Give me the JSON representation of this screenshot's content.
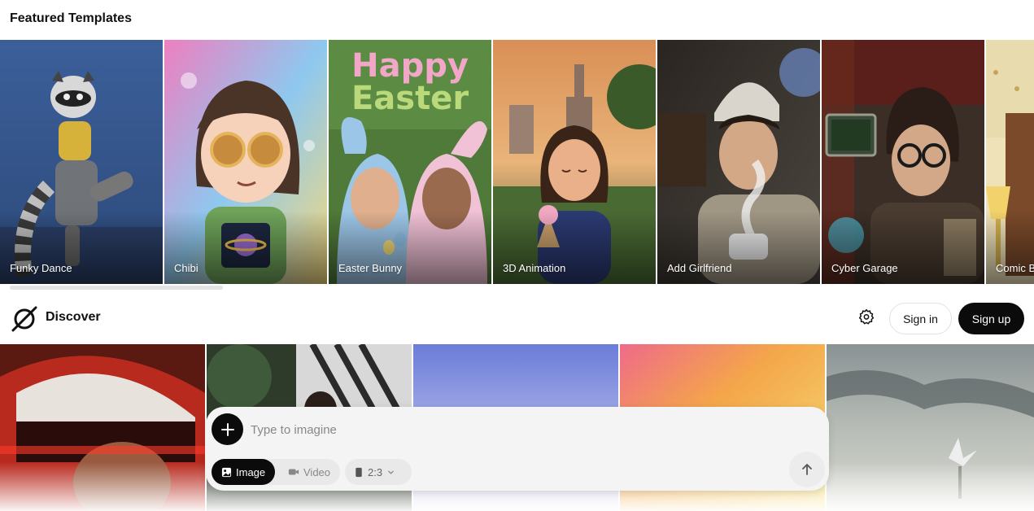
{
  "featured": {
    "title": "Featured Templates",
    "templates": [
      {
        "label": "Funky Dance"
      },
      {
        "label": "Chibi"
      },
      {
        "label": "Easter Bunny"
      },
      {
        "label": "3D Animation"
      },
      {
        "label": "Add Girlfriend"
      },
      {
        "label": "Cyber Garage"
      },
      {
        "label": "Comic B"
      }
    ]
  },
  "header": {
    "title": "Discover",
    "sign_in": "Sign in",
    "sign_up": "Sign up",
    "settings_icon": "gear-icon",
    "logo_icon": "brand-logo"
  },
  "easter_art": {
    "line1": "Happy",
    "line2": "Easter"
  },
  "composer": {
    "placeholder": "Type to imagine",
    "modes": [
      {
        "label": "Image",
        "icon": "image-icon",
        "active": true
      },
      {
        "label": "Video",
        "icon": "video-icon",
        "active": false
      }
    ],
    "aspect_ratio": "2:3",
    "add_icon": "plus-icon",
    "send_icon": "arrow-up-icon"
  },
  "colors": {
    "primary_button": "#0b0b0b",
    "composer_bg": "#f4f4f4"
  }
}
